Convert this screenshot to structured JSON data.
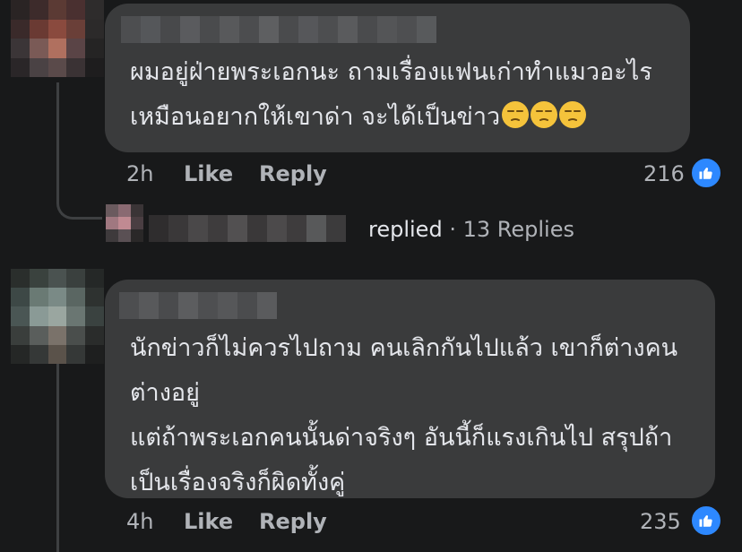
{
  "comments": [
    {
      "text_lines": [
        "ผมอยู่ฝ่ายพระเอกนะ ถามเรื่องแฟนเก่าทำแมวอะไร",
        "เหมือนอยากให้เขาด่า จะได้เป็นข่าว"
      ],
      "emojis": [
        "unamused-face-emoji",
        "unamused-face-emoji",
        "unamused-face-emoji"
      ],
      "time": "2h",
      "like_label": "Like",
      "reply_label": "Reply",
      "reaction_count": "216"
    },
    {
      "text_lines": [
        "นักข่าวก็ไม่ควรไปถาม คนเลิกกันไปแล้ว เขาก็ต่างคน",
        "ต่างอยู่",
        "แต่ถ้าพระเอกคนนั้นด่าจริงๆ อันนี้ก็แรงเกินไป สรุปถ้า",
        "เป็นเรื่องจริงก็ผิดทั้งคู่"
      ],
      "time": "4h",
      "like_label": "Like",
      "reply_label": "Reply",
      "reaction_count": "235"
    }
  ],
  "replies_summary": {
    "replied_label": "replied",
    "separator": "·",
    "count_label": "13 Replies"
  },
  "colors": {
    "background": "#18191a",
    "bubble": "#3a3b3c",
    "text": "#e4e6eb",
    "secondary_text": "#b0b3b8",
    "like_blue": "#2d88ff"
  }
}
